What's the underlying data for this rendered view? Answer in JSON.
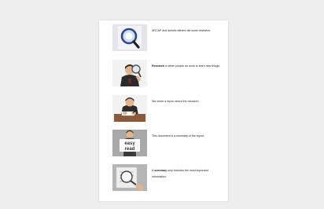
{
  "document": {
    "items": [
      {
        "text": "ARCAP and autistic fathers did some research.",
        "image": "magnifying-glass-logo"
      },
      {
        "bold": "Research",
        "text": " is when people do work to learn new things.",
        "image": "person-with-magnifier"
      },
      {
        "text": "We wrote a report about the research.",
        "image": "person-writing-at-desk"
      },
      {
        "text": "This document is a summary of the report.",
        "image": "easy-read-sign"
      },
      {
        "pre": "A ",
        "bold": "summary",
        "text": " only includes the most important information.",
        "image": "document-with-magnifier"
      }
    ]
  }
}
